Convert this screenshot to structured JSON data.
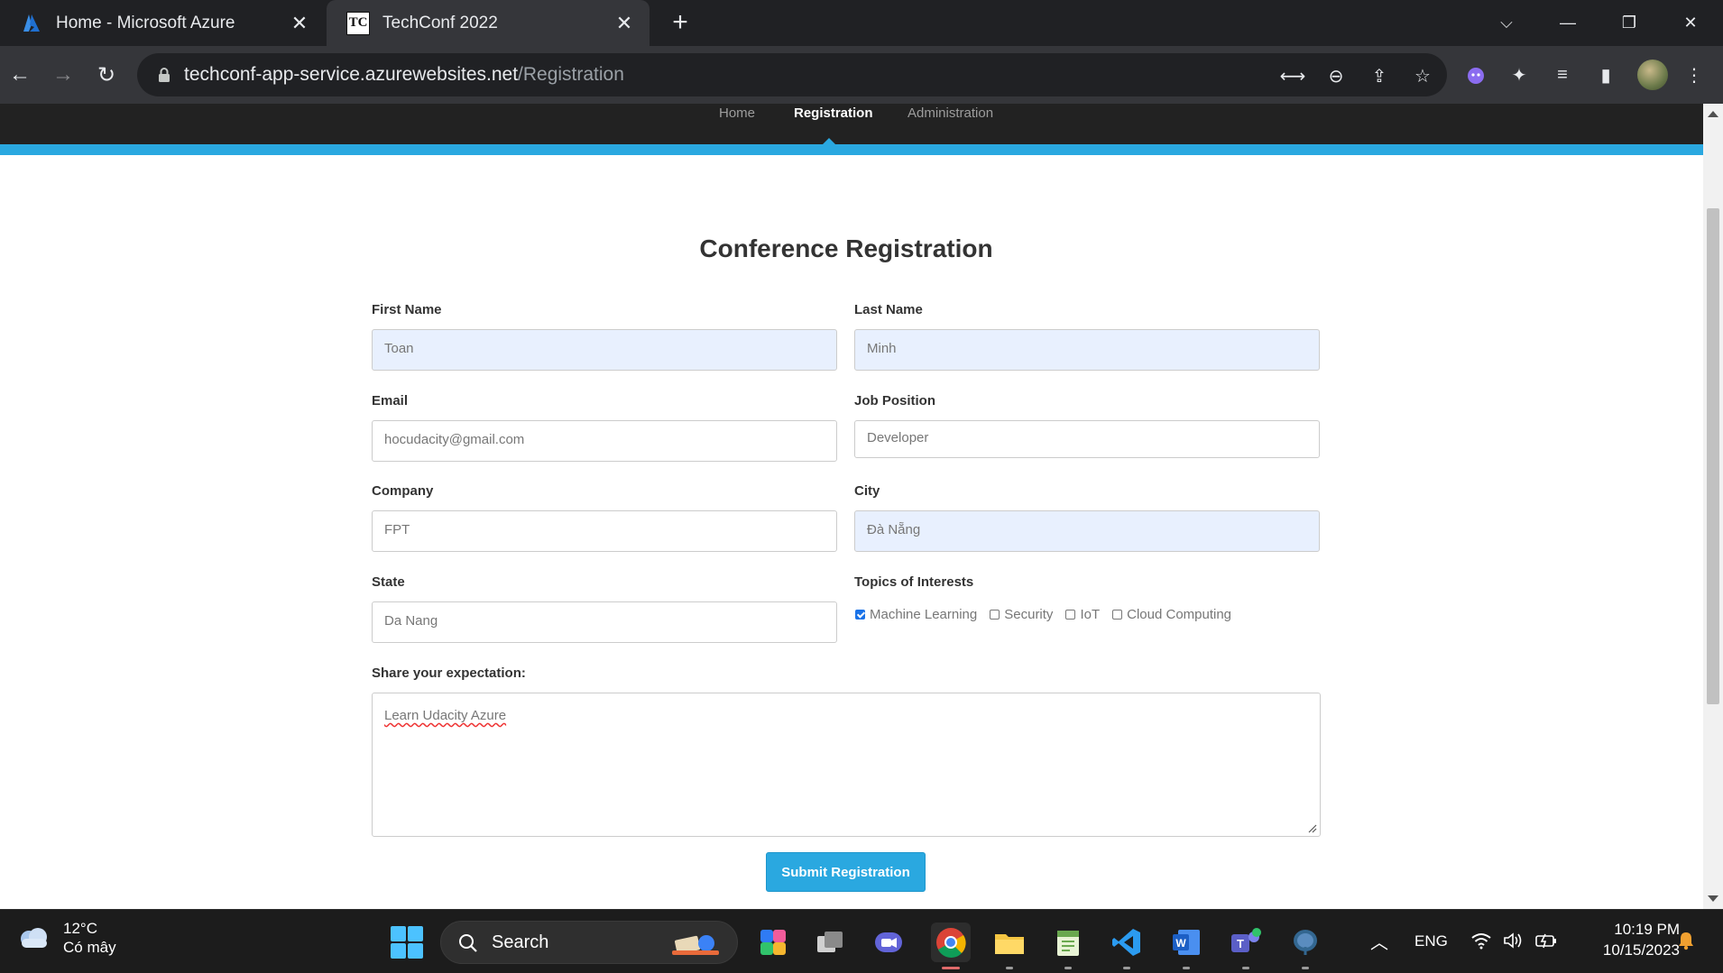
{
  "browser": {
    "tabs": [
      {
        "title": "Home - Microsoft Azure",
        "icon": "azure-icon"
      },
      {
        "title": "TechConf 2022",
        "icon_text": "TC"
      }
    ],
    "url_host": "techconf-app-service.azurewebsites.net",
    "url_path": "/Registration"
  },
  "site_nav": {
    "items": [
      "Home",
      "Registration",
      "Administration"
    ],
    "active": "Registration"
  },
  "form": {
    "title": "Conference Registration",
    "first_name": {
      "label": "First Name",
      "value": "Toan"
    },
    "last_name": {
      "label": "Last Name",
      "value": "Minh"
    },
    "email": {
      "label": "Email",
      "value": "hocudacity@gmail.com"
    },
    "job_position": {
      "label": "Job Position",
      "value": "Developer"
    },
    "company": {
      "label": "Company",
      "value": "FPT"
    },
    "city": {
      "label": "City",
      "value": "Đà Nẵng"
    },
    "state": {
      "label": "State",
      "value": "Da Nang"
    },
    "topics": {
      "label": "Topics of Interests",
      "options": [
        {
          "label": "Machine Learning",
          "checked": true
        },
        {
          "label": "Security",
          "checked": false
        },
        {
          "label": "IoT",
          "checked": false
        },
        {
          "label": "Cloud Computing",
          "checked": false
        }
      ]
    },
    "expectation": {
      "label": "Share your expectation:",
      "value": "Learn Udacity Azure"
    },
    "submit_label": "Submit Registration"
  },
  "taskbar": {
    "weather_temp": "12°C",
    "weather_condition": "Có mây",
    "search_placeholder": "Search",
    "language": "ENG",
    "time": "10:19 PM",
    "date": "10/15/2023"
  },
  "colors": {
    "accent_blue": "#2aa8e0",
    "nav_dark": "#222222",
    "autofill": "#e8f0fe"
  }
}
